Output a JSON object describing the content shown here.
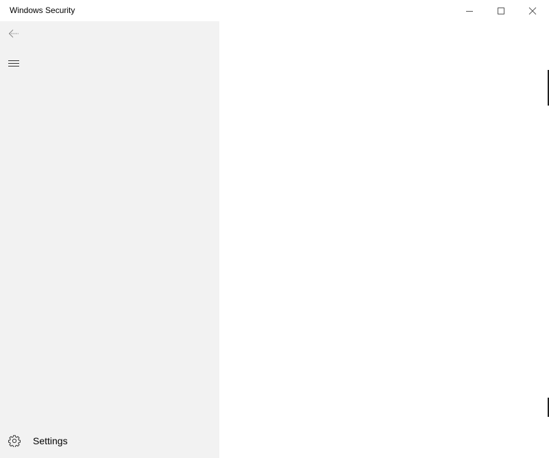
{
  "window": {
    "title": "Windows Security"
  },
  "caption_buttons": {
    "minimize_icon": "minimize-icon",
    "maximize_icon": "maximize-icon",
    "close_icon": "close-icon"
  },
  "sidebar": {
    "back_icon": "back-arrow-icon",
    "menu_icon": "hamburger-menu-icon",
    "settings": {
      "label": "Settings",
      "icon": "gear-icon"
    }
  },
  "colors": {
    "sidebar_bg": "#f2f2f2",
    "content_bg": "#ffffff",
    "titlebar_bg": "#ffffff",
    "icon_color": "#555555"
  }
}
